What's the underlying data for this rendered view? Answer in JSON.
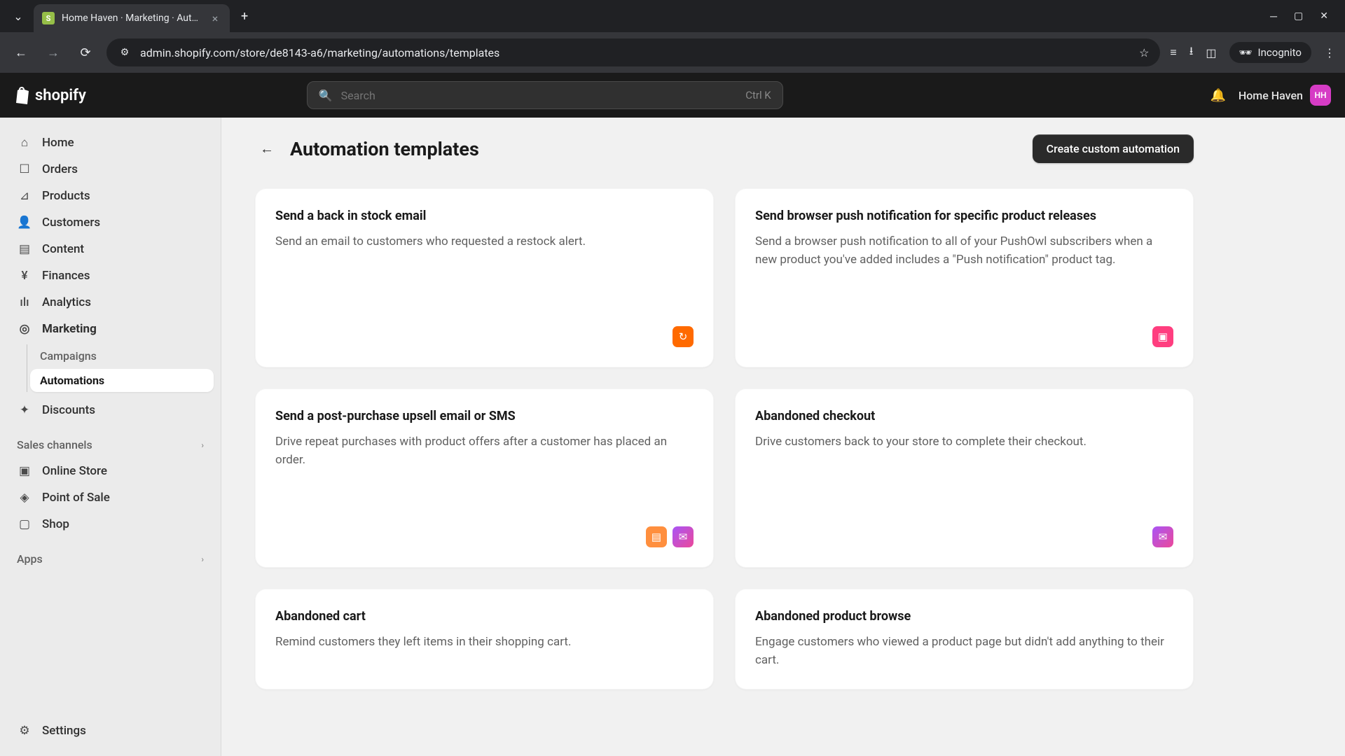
{
  "browser": {
    "tab_title": "Home Haven · Marketing · Aut…",
    "url": "admin.shopify.com/store/de8143-a6/marketing/automations/templates",
    "incognito_label": "Incognito"
  },
  "topbar": {
    "logo_text": "shopify",
    "search_placeholder": "Search",
    "search_kbd": "Ctrl K",
    "store_name": "Home Haven",
    "avatar_initials": "HH"
  },
  "sidebar": {
    "items": [
      {
        "icon": "⌂",
        "label": "Home"
      },
      {
        "icon": "☐",
        "label": "Orders"
      },
      {
        "icon": "⊿",
        "label": "Products"
      },
      {
        "icon": "👤",
        "label": "Customers"
      },
      {
        "icon": "▤",
        "label": "Content"
      },
      {
        "icon": "¥",
        "label": "Finances"
      },
      {
        "icon": "ılı",
        "label": "Analytics"
      },
      {
        "icon": "◎",
        "label": "Marketing",
        "active": true,
        "subs": [
          {
            "label": "Campaigns"
          },
          {
            "label": "Automations",
            "active": true
          }
        ]
      },
      {
        "icon": "✦",
        "label": "Discounts"
      }
    ],
    "sales_channels_label": "Sales channels",
    "channels": [
      {
        "icon": "▣",
        "label": "Online Store"
      },
      {
        "icon": "◈",
        "label": "Point of Sale"
      },
      {
        "icon": "▢",
        "label": "Shop"
      }
    ],
    "apps_label": "Apps",
    "settings_label": "Settings"
  },
  "page": {
    "title": "Automation templates",
    "create_button": "Create custom automation"
  },
  "cards": [
    {
      "title": "Send a back in stock email",
      "desc": "Send an email to customers who requested a restock alert.",
      "icons": [
        "orange"
      ]
    },
    {
      "title": "Send browser push notification for specific product releases",
      "desc": "Send a browser push notification to all of your PushOwl subscribers when a new product you've added includes a \"Push notification\" product tag.",
      "icons": [
        "pink"
      ]
    },
    {
      "title": "Send a post-purchase upsell email or SMS",
      "desc": "Drive repeat purchases with product offers after a customer has placed an order.",
      "icons": [
        "orange-light",
        "purple"
      ]
    },
    {
      "title": "Abandoned checkout",
      "desc": "Drive customers back to your store to complete their checkout.",
      "icons": [
        "purple"
      ]
    },
    {
      "title": "Abandoned cart",
      "desc": "Remind customers they left items in their shopping cart.",
      "icons": []
    },
    {
      "title": "Abandoned product browse",
      "desc": "Engage customers who viewed a product page but didn't add anything to their cart.",
      "icons": []
    }
  ]
}
